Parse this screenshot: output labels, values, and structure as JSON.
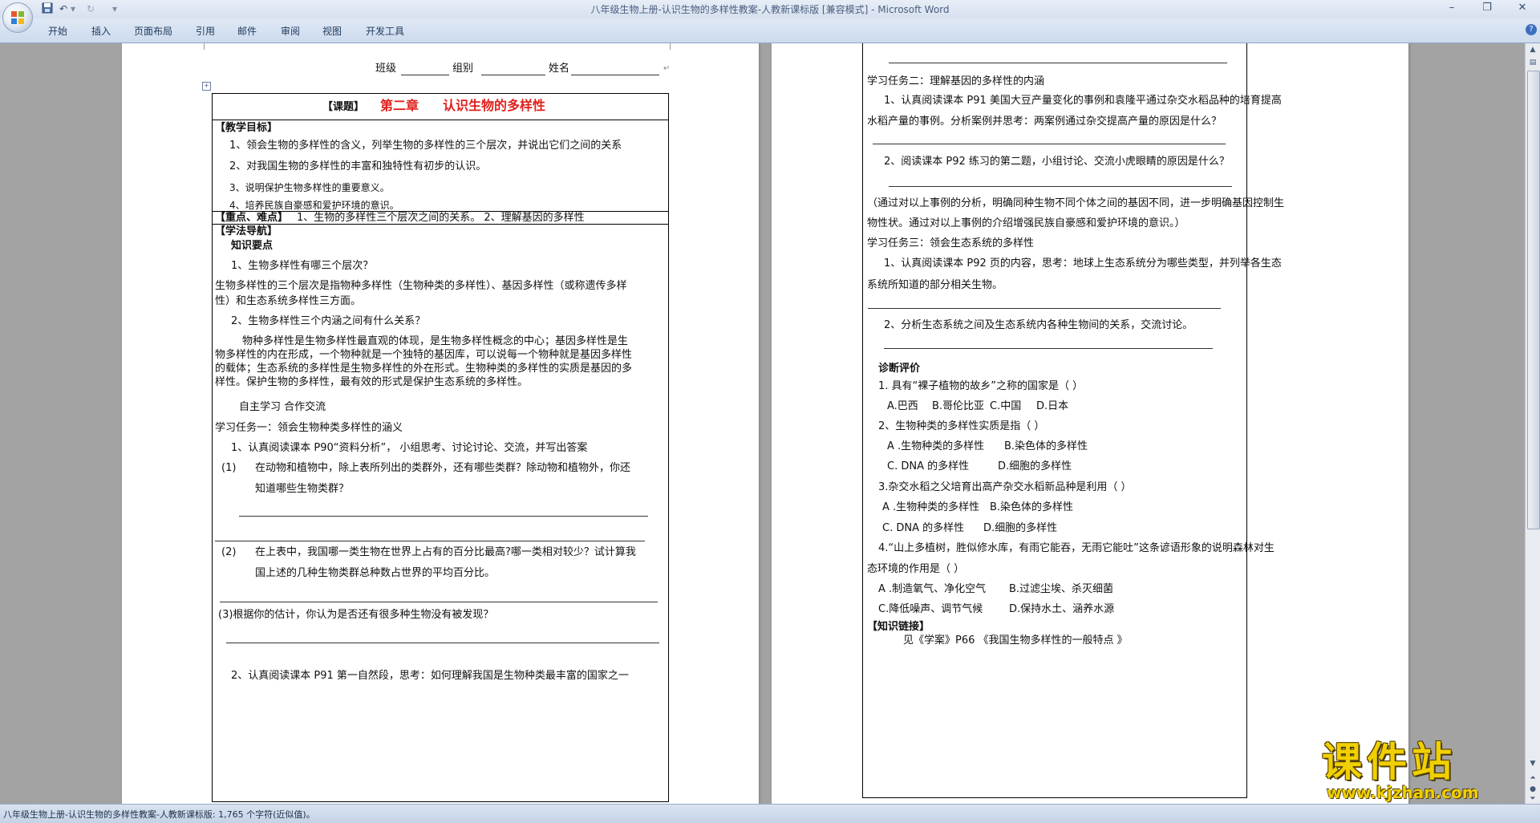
{
  "window": {
    "title": "八年级生物上册-认识生物的多样性教案-人教新课标版 [兼容模式] - Microsoft Word",
    "controls": [
      "–",
      "❐",
      "✕"
    ]
  },
  "qat": {
    "undo": "↶",
    "redo": "↻",
    "dropdown": "▾"
  },
  "ribbon": {
    "tabs": [
      "开始",
      "插入",
      "页面布局",
      "引用",
      "邮件",
      "审阅",
      "视图",
      "开发工具"
    ],
    "help": "?"
  },
  "page1": {
    "header": {
      "class_label": "班级",
      "group_label": "组别",
      "name_label": "姓名"
    },
    "topic": {
      "label": "【课题】",
      "chapter": "第二章",
      "title": "认识生物的多样性"
    },
    "goals_label": "【教学目标】",
    "goals": [
      "1、领会生物的多样性的含义，列举生物的多样性的三个层次，并说出它们之间的关系",
      "2、对我国生物的多样性的丰富和独特性有初步的认识。",
      "3、说明保护生物多样性的重要意义。",
      "4、培养民族自豪感和爱护环境的意识。"
    ],
    "key_label": "【重点、难点】",
    "key_text": "1、生物的多样性三个层次之间的关系。  2、理解基因的多样性",
    "guide_label": "【学法导航】",
    "knowledge_label": "知识要点",
    "q1": "1、生物多样性有哪三个层次？",
    "a1_line1": "生物多样性的三个层次是指物种多样性（生物种类的多样性）、基因多样性（或称遗传多样",
    "a1_line2": "性）和生态系统多样性三方面。",
    "q2": "2、生物多样性三个内涵之间有什么关系？",
    "a2_lines": [
      "物种多样性是生物多样性最直观的体现，是生物多样性概念的中心；基因多样性是生",
      "物多样性的内在形成，一个物种就是一个独特的基因库，可以说每一个物种就是基因多样性",
      "的载体；生态系统的多样性是生物多样性的外在形式。生物种类的多样性的实质是基因的多",
      "样性。保护生物的多样性，最有效的形式是保护生态系统的多样性。"
    ],
    "self_study": "自主学习  合作交流",
    "task1": "学习任务一：领会生物种类多样性的涵义",
    "task1_item1": "1、认真阅读课本 P90“资料分析”， 小组思考、讨论讨论、交流，并写出答案",
    "sub1_num": "(1)",
    "sub1_line1": "在动物和植物中，除上表所列出的类群外，还有哪些类群？除动物和植物外，你还",
    "sub1_line2": "知道哪些生物类群？",
    "sub2_num": "(2)",
    "sub2_line1": "在上表中，我国哪一类生物在世界上占有的百分比最高?哪一类相对较少？试计算我",
    "sub2_line2": "国上述的几种生物类群总种数占世界的平均百分比。",
    "sub3": "(3)根据你的估计，你认为是否还有很多种生物没有被发现？",
    "item2": "2、认真阅读课本 P91 第一自然段，思考：如何理解我国是生物种类最丰富的国家之一"
  },
  "page2": {
    "task2": "学习任务二：理解基因的多样性的内涵",
    "t2_item1_line1": "1、认真阅读课本 P91 美国大豆产量变化的事例和袁隆平通过杂交水稻品种的培育提高",
    "t2_item1_line2": "水稻产量的事例。分析案例并思考：两案例通过杂交提高产量的原因是什么？",
    "t2_item2": "2、阅读课本 P92 练习的第二题，小组讨论、交流小虎眼睛的原因是什么？",
    "summary_line1": "（通过对以上事例的分析，明确同种生物不同个体之间的基因不同，进一步明确基因控制生",
    "summary_line2": "物性状。通过对以上事例的介绍增强民族自豪感和爱护环境的意识。）",
    "task3": "学习任务三：领会生态系统的多样性",
    "t3_item1_line1": "1、认真阅读课本 P92 页的内容，思考：地球上生态系统分为哪些类型，并列举各生态",
    "t3_item1_line2": "系统所知道的部分相关生物。",
    "t3_item2": "2、分析生态系统之间及生态系统内各种生物间的关系，交流讨论。",
    "eval_label": "诊断评价",
    "q1": "1. 具有“裸子植物的故乡”之称的国家是（  ）",
    "q1_opts": [
      "A.巴西",
      "B.哥伦比亚",
      "C.中国",
      "D.日本"
    ],
    "q2": "2、生物种类的多样性实质是指（   ）",
    "q2_opts": [
      "A .生物种类的多样性",
      "B.染色体的多样性",
      "C. DNA 的多样性",
      "D.细胞的多样性"
    ],
    "q3": "3.杂交水稻之父培育出高产杂交水稻新品种是利用（  ）",
    "q3_opts": [
      "A .生物种类的多样性",
      "B.染色体的多样性",
      "C. DNA 的多样性",
      "D.细胞的多样性"
    ],
    "q4_line1": "4.“山上多植树，胜似修水库，有雨它能吞，无雨它能吐”这条谚语形象的说明森林对生",
    "q4_line2": "态环境的作用是（  ）",
    "q4_opts": [
      "A .制造氧气、净化空气",
      "B.过滤尘埃、杀灭细菌",
      "C.降低噪声、调节气候",
      "D.保持水土、涵养水源"
    ],
    "link_label": "【知识链接】",
    "link_text": "见《学案》P66    《我国生物多样性的一般特点 》"
  },
  "status": {
    "text": "八年级生物上册-认识生物的多样性教案-人教新课标版: 1,765 个字符(近似值)。"
  },
  "watermark": {
    "cn": "课件站",
    "url": "www.kjzhan.com"
  },
  "colors": {
    "topic_red": "#e0201c",
    "title_blue": "#4a5f80"
  }
}
